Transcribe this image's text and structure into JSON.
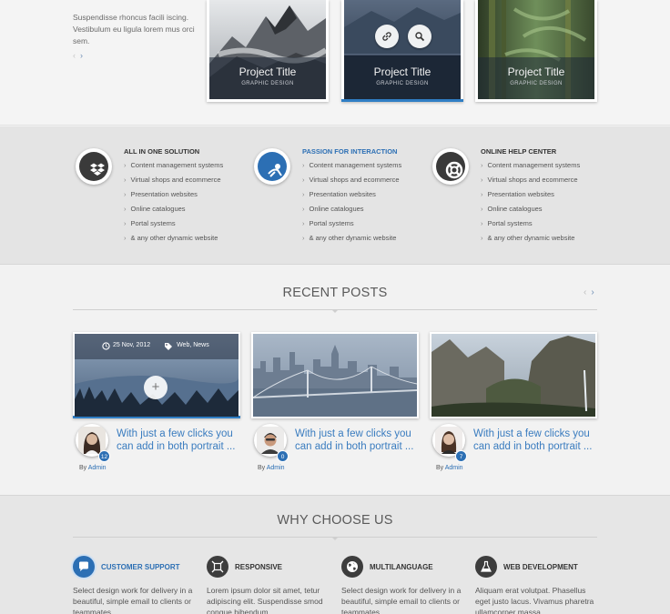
{
  "intro": {
    "text": "Suspendisse rhoncus facili iscing. Vestibulum eu ligula lorem mus orci sem."
  },
  "projects": [
    {
      "title": "Project Title",
      "subtitle": "GRAPHIC DESIGN",
      "image": "mountains"
    },
    {
      "title": "Project Title",
      "subtitle": "GRAPHIC DESIGN",
      "image": "mountain-lake",
      "active": true
    },
    {
      "title": "Project Title",
      "subtitle": "GRAPHIC DESIGN",
      "image": "bamboo-forest"
    }
  ],
  "features": [
    {
      "title": "ALL IN ONE SOLUTION",
      "icon": "dropbox-icon",
      "items": [
        "Content management systems",
        "Virtual shops and ecommerce",
        "Presentation websites",
        "Online catalogues",
        "Portal systems",
        "& any other dynamic website"
      ]
    },
    {
      "title": "PASSION FOR INTERACTION",
      "icon": "interaction-icon",
      "highlight": true,
      "items": [
        "Content management systems",
        "Virtual shops and ecommerce",
        "Presentation websites",
        "Online catalogues",
        "Portal systems",
        "& any other dynamic website"
      ]
    },
    {
      "title": "ONLINE HELP CENTER",
      "icon": "lifebuoy-icon",
      "items": [
        "Content management systems",
        "Virtual shops and ecommerce",
        "Presentation websites",
        "Online catalogues",
        "Portal systems",
        "& any other dynamic website"
      ]
    }
  ],
  "recent_posts": {
    "title": "RECENT POSTS",
    "posts": [
      {
        "date": "25 Nov, 2012",
        "tags": "Web, News",
        "text": "With just a few clicks you can add in both portrait ...",
        "by": "By",
        "author": "Admin",
        "comments": "12",
        "image": "forest-lake"
      },
      {
        "text": "With just a few clicks you can add in both portrait ...",
        "by": "By",
        "author": "Admin",
        "comments": "0",
        "image": "city-bridge"
      },
      {
        "text": "With just a few clicks you can add in both portrait ...",
        "by": "By",
        "author": "Admin",
        "comments": "7",
        "image": "valley"
      }
    ]
  },
  "why_choose_us": {
    "title": "WHY CHOOSE US",
    "items": [
      {
        "title": "CUSTOMER SUPPORT",
        "icon": "chat-icon",
        "highlight": true,
        "text": "Select design work for delivery in a beautiful, simple email to clients or teammates."
      },
      {
        "title": "RESPONSIVE",
        "icon": "resize-icon",
        "text": "Lorem ipsum dolor sit amet, tetur adipiscing elit. Suspendisse smod congue bibendum."
      },
      {
        "title": "MULTILANGUAGE",
        "icon": "globe-icon",
        "text": "Select design work for delivery in a beautiful, simple email to clients or teammates."
      },
      {
        "title": "WEB DEVELOPMENT",
        "icon": "flask-icon",
        "text": "Aliquam erat volutpat. Phasellus eget justo lacus. Vivamus pharetra ullamcorper massa."
      }
    ]
  },
  "colors": {
    "accent": "#2c6fb4",
    "text": "#555555",
    "link": "#3a7cbf"
  }
}
